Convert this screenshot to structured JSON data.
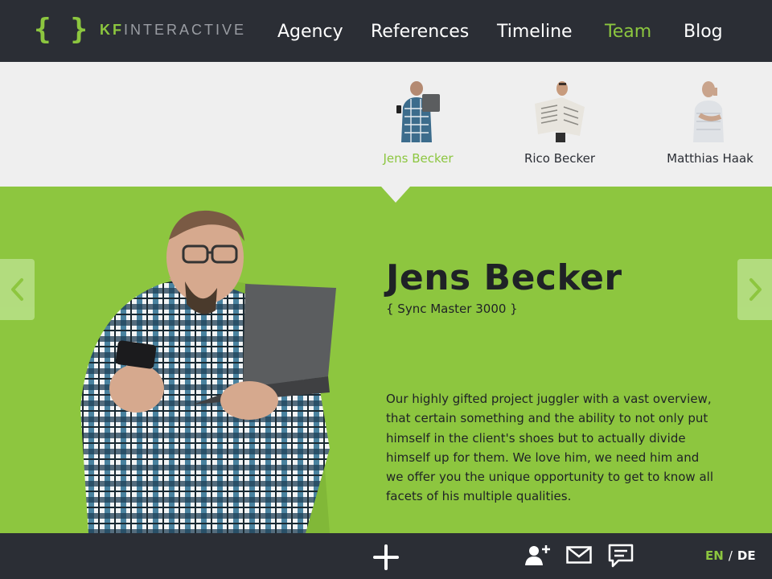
{
  "brand": {
    "braces": "{ }",
    "name_accent": "KF",
    "name_rest": "INTERACTIVE"
  },
  "nav": {
    "items": [
      {
        "label": "Agency",
        "active": false
      },
      {
        "label": "References",
        "active": false
      },
      {
        "label": "Timeline",
        "active": false
      },
      {
        "label": "Team",
        "active": true
      },
      {
        "label": "Blog",
        "active": false
      }
    ]
  },
  "team": {
    "members": [
      {
        "name": "Jens Becker",
        "active": true,
        "photo_icon": "person-with-laptop-icon"
      },
      {
        "name": "Rico Becker",
        "active": false,
        "photo_icon": "person-reading-newspaper-icon"
      },
      {
        "name": "Matthias Haak",
        "active": false,
        "photo_icon": "person-on-phone-icon"
      }
    ]
  },
  "profile": {
    "name": "Jens Becker",
    "role": "{ Sync Master 3000 }",
    "bio": "Our highly gifted project juggler with a vast overview, that certain something and the ability to not only put himself in the client's shoes but to actually divide himself up for them. We love him, we need him and we offer you the unique opportunity to get to know all facets of his multiple qualities."
  },
  "carousel": {
    "prev_icon": "chevron-left-icon",
    "next_icon": "chevron-right-icon"
  },
  "footer": {
    "icons": [
      "plus-icon",
      "add-user-icon",
      "mail-icon",
      "chat-icon"
    ],
    "lang_en": "EN",
    "lang_sep": "/",
    "lang_de": "DE"
  },
  "colors": {
    "accent": "#8cc63f",
    "dark": "#2b2e35",
    "hero": "#8dc63f",
    "strip": "#efefef"
  }
}
